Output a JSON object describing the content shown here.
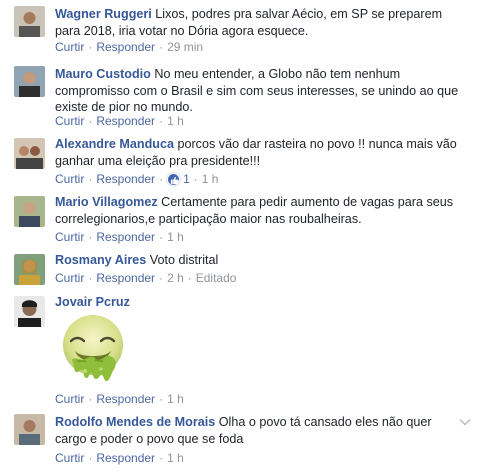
{
  "comments": [
    {
      "name": "Wagner Ruggeri",
      "text": "Lixos, podres pra salvar Aécio, em SP se preparem para 2018, iria votar no Dória agora esquece.",
      "like": "Curtir",
      "reply": "Responder",
      "time": "29 min"
    },
    {
      "name": "Mauro Custodio",
      "text": "No meu entender, a Globo não tem nenhum compromisso com o Brasil e sim com seus interesses, se unindo ao que existe de pior no mundo.",
      "like": "Curtir",
      "reply": "Responder",
      "time": "1 h"
    },
    {
      "name": "Alexandre Manduca",
      "text": "porcos vão dar rasteira no povo !! nunca mais vão ganhar uma eleição pra presidente!!!",
      "like": "Curtir",
      "reply": "Responder",
      "reactions": "1",
      "time": "1 h"
    },
    {
      "name": "Mario Villagomez",
      "text": "Certamente para pedir aumento de vagas para seus correlegionarios,e participação maior nas roubalheiras.",
      "like": "Curtir",
      "reply": "Responder",
      "time": "1 h"
    },
    {
      "name": "Rosmany Aires",
      "text": "Voto distrital",
      "like": "Curtir",
      "reply": "Responder",
      "time": "2 h",
      "edited": "Editado"
    },
    {
      "name": "Jovair Pcruz",
      "text": "",
      "like": "Curtir",
      "reply": "Responder",
      "time": "1 h"
    },
    {
      "name": "Rodolfo Mendes de Morais",
      "text": "Olha o povo tá cansado eles não quer cargo e poder o povo que se foda",
      "like": "Curtir",
      "reply": "Responder",
      "time": "1 h"
    }
  ],
  "icons": {
    "reaction": "like-reaction-icon",
    "sticker": "vomit-face-sticker",
    "menu": "chevron-down-icon"
  },
  "colors": {
    "name": "#365899",
    "link": "#4b67a1",
    "meta": "#90949c",
    "text": "#1d2129",
    "like_blue": "#4267b2"
  }
}
